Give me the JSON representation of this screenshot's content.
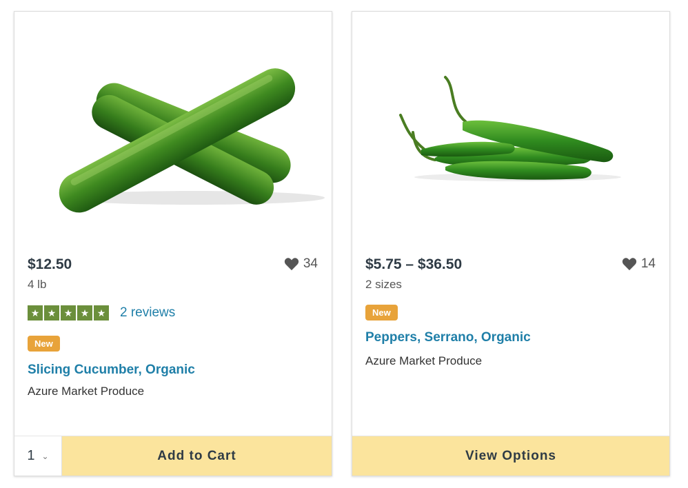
{
  "products": [
    {
      "price": "$12.50",
      "favorites": "34",
      "unit": "4 lb",
      "rating": {
        "stars": 5,
        "reviews_label": "2 reviews"
      },
      "badge": "New",
      "name": "Slicing Cucumber, Organic",
      "vendor": "Azure Market Produce",
      "quantity": "1",
      "cta_label": "Add to Cart",
      "image_icon": "cucumber-image"
    },
    {
      "price": "$5.75 – $36.50",
      "favorites": "14",
      "unit": "2 sizes",
      "badge": "New",
      "name": "Peppers, Serrano, Organic",
      "vendor": "Azure Market Produce",
      "cta_label": "View Options",
      "image_icon": "serrano-pepper-image"
    }
  ],
  "colors": {
    "link": "#1f7fa8",
    "badge": "#e8a33a",
    "cta": "#fbe49d",
    "star": "#6b8f3b"
  }
}
